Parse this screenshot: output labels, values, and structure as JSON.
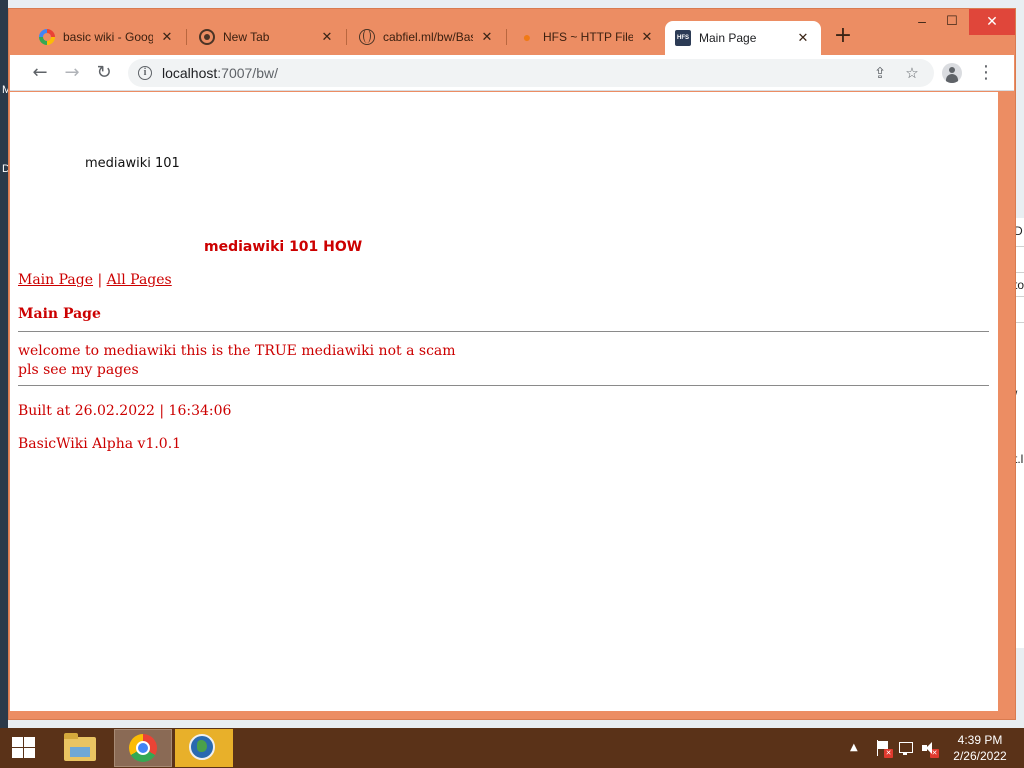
{
  "browser": {
    "tabs": [
      {
        "title": "basic wiki - Google",
        "favicon": "google-icon",
        "active": false
      },
      {
        "title": "New Tab",
        "favicon": "chrome-icon",
        "active": false
      },
      {
        "title": "cabfiel.ml/bw/Basic",
        "favicon": "globe-icon",
        "active": false
      },
      {
        "title": "HFS ~ HTTP File Server",
        "favicon": "hfs-icon",
        "active": false
      },
      {
        "title": "Main Page",
        "favicon": "hfs-logo-icon",
        "active": true
      }
    ],
    "close_glyph": "✕",
    "new_tab_glyph": "+",
    "window_controls": {
      "minimize": "–",
      "maximize": "☐",
      "close": "✕"
    },
    "nav": {
      "back": "←",
      "forward": "→",
      "reload": "↻"
    },
    "address": {
      "host": "localhost",
      "path": ":7007/bw/"
    },
    "menu_glyph": "⋮",
    "accent_color": "#ec8d63"
  },
  "wiki": {
    "header_text": "mediawiki 101",
    "subtitle": "mediawiki 101 HOW",
    "nav_links": [
      "Main Page",
      "All Pages"
    ],
    "nav_separator": " | ",
    "page_title": "Main Page",
    "body_lines": [
      "welcome to mediawiki this is the TRUE mediawiki not a scam",
      "pls see my pages"
    ],
    "built_text": "Built at 26.02.2022 | 16:34:06",
    "version_text": "BasicWiki Alpha v1.0.1",
    "text_color": "#cc0000"
  },
  "desktop": {
    "left_edge_chars": [
      "M",
      "D"
    ],
    "right_edge_chars": [
      "D",
      "to",
      "/",
      "t.l"
    ]
  },
  "taskbar": {
    "apps": [
      "file-explorer-icon",
      "chrome-icon",
      "network-globe-icon"
    ],
    "tray_expand": "▲",
    "clock_time": "4:39 PM",
    "clock_date": "2/26/2022"
  }
}
